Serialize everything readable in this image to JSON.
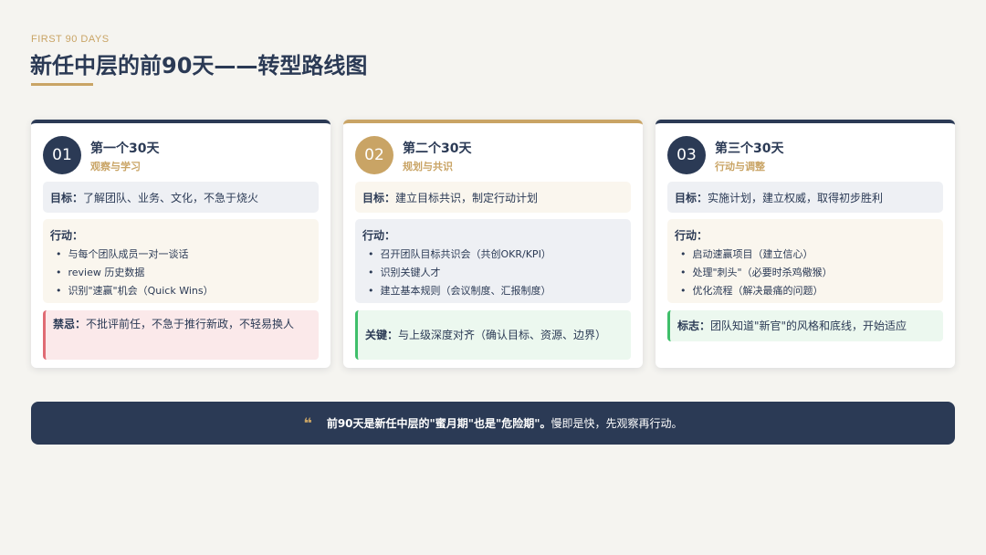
{
  "header": {
    "eyebrow": "FIRST 90 DAYS",
    "title": "新任中层的前90天——转型路线图"
  },
  "cards": [
    {
      "number": "01",
      "title": "第一个30天",
      "subtitle": "观察与学习",
      "goal_label": "目标：",
      "goal_text": "了解团队、业务、文化，不急于烧火",
      "actions_label": "行动：",
      "actions": [
        "与每个团队成员一对一谈话",
        "review 历史数据",
        "识别\"速赢\"机会（Quick Wins）"
      ],
      "note_label": "禁忌：",
      "note_text": "不批评前任，不急于推行新政，不轻易换人"
    },
    {
      "number": "02",
      "title": "第二个30天",
      "subtitle": "规划与共识",
      "goal_label": "目标：",
      "goal_text": "建立目标共识，制定行动计划",
      "actions_label": "行动：",
      "actions": [
        "召开团队目标共识会（共创OKR/KPI）",
        "识别关键人才",
        "建立基本规则（会议制度、汇报制度）"
      ],
      "note_label": "关键：",
      "note_text": "与上级深度对齐（确认目标、资源、边界）"
    },
    {
      "number": "03",
      "title": "第三个30天",
      "subtitle": "行动与调整",
      "goal_label": "目标：",
      "goal_text": "实施计划，建立权威，取得初步胜利",
      "actions_label": "行动：",
      "actions": [
        "启动速赢项目（建立信心）",
        "处理\"刺头\"（必要时杀鸡儆猴）",
        "优化流程（解决最痛的问题）"
      ],
      "note_label": "标志：",
      "note_text": "团队知道\"新官\"的风格和底线，开始适应"
    }
  ],
  "quote": {
    "mark": "❝",
    "strong": "前90天是新任中层的\"蜜月期\"也是\"危险期\"。",
    "rest": "慢即是快，先观察再行动。"
  },
  "colors": {
    "navy": "#2b3a55",
    "gold": "#c9a465",
    "red": "#e06b74",
    "green": "#3fbf6a",
    "background": "#f5f4f0"
  }
}
